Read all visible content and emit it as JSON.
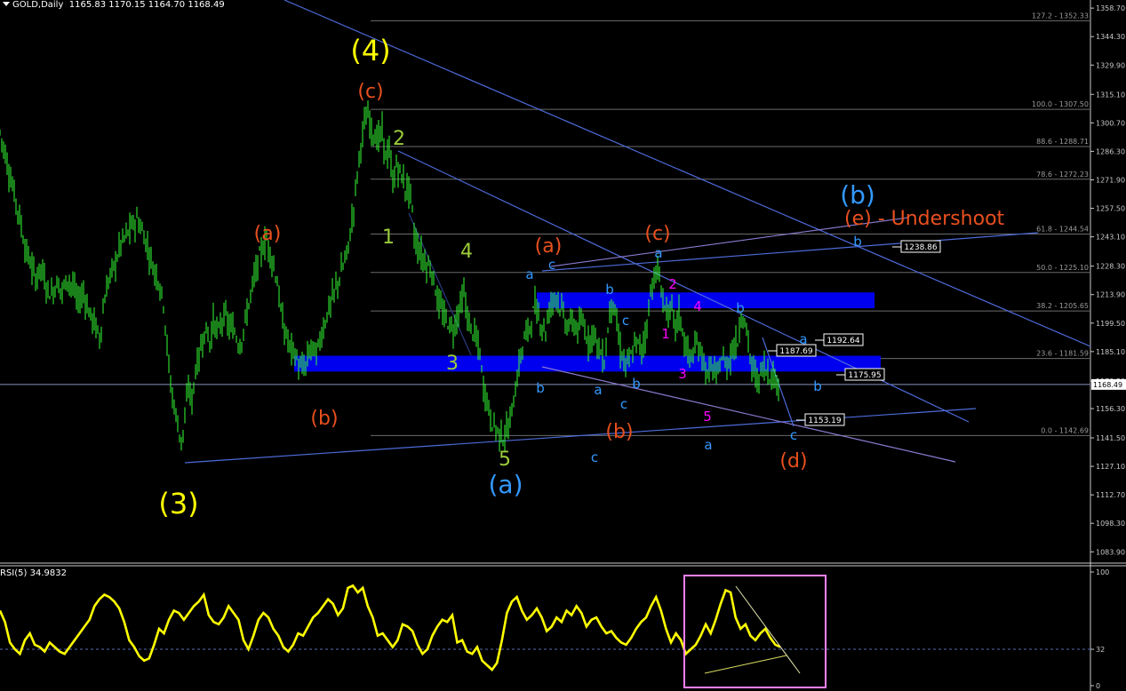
{
  "header": {
    "symbol": "GOLD,Daily",
    "ohlc": "1165.83 1170.15 1164.70 1168.49"
  },
  "rsi_header": {
    "label": "RSI(5) 34.9832"
  },
  "colors": {
    "background": "#000000",
    "candle": "#33ff33",
    "trendline": "#4d6bd9",
    "wave_count_b": "#3399ff",
    "wave_count_red": "#e8501e",
    "wave_count_yellow": "#ffff00",
    "wave_count_green": "#9ccc3a",
    "wave_count_magenta": "#ff00ff",
    "support_zone": "#0000ee",
    "rsi_line": "#ffff00",
    "rsi_box": "#ff80ff"
  },
  "chart_data": [
    {
      "type": "candlestick",
      "title": "GOLD,Daily",
      "price_axis": {
        "ticks": [
          "1358.70",
          "1344.30",
          "1329.90",
          "1315.10",
          "1300.70",
          "1286.30",
          "1271.90",
          "1257.50",
          "1243.10",
          "1228.30",
          "1213.90",
          "1199.50",
          "1185.10",
          "1170.30",
          "1156.30",
          "1141.50",
          "1127.10",
          "1112.70",
          "1098.30",
          "1083.90"
        ],
        "range": [
          1080.0,
          1361.0
        ],
        "current_price": "1168.49"
      },
      "close_path": [
        [
          0,
          1296
        ],
        [
          6,
          1285
        ],
        [
          10,
          1276
        ],
        [
          16,
          1265
        ],
        [
          22,
          1253
        ],
        [
          28,
          1238
        ],
        [
          34,
          1230
        ],
        [
          40,
          1222
        ],
        [
          46,
          1228
        ],
        [
          52,
          1218
        ],
        [
          58,
          1214
        ],
        [
          64,
          1220
        ],
        [
          70,
          1216
        ],
        [
          76,
          1222
        ],
        [
          82,
          1218
        ],
        [
          88,
          1210
        ],
        [
          94,
          1215
        ],
        [
          100,
          1205
        ],
        [
          106,
          1200
        ],
        [
          112,
          1192
        ],
        [
          118,
          1212
        ],
        [
          124,
          1224
        ],
        [
          130,
          1230
        ],
        [
          136,
          1240
        ],
        [
          142,
          1244
        ],
        [
          148,
          1248
        ],
        [
          154,
          1252
        ],
        [
          160,
          1246
        ],
        [
          166,
          1238
        ],
        [
          172,
          1228
        ],
        [
          178,
          1222
        ],
        [
          184,
          1210
        ],
        [
          188,
          1188
        ],
        [
          192,
          1168
        ],
        [
          196,
          1158
        ],
        [
          200,
          1148
        ],
        [
          204,
          1140
        ],
        [
          208,
          1150
        ],
        [
          212,
          1168
        ],
        [
          216,
          1160
        ],
        [
          220,
          1176
        ],
        [
          224,
          1182
        ],
        [
          228,
          1192
        ],
        [
          232,
          1196
        ],
        [
          236,
          1190
        ],
        [
          240,
          1200
        ],
        [
          246,
          1195
        ],
        [
          252,
          1204
        ],
        [
          258,
          1198
        ],
        [
          264,
          1195
        ],
        [
          270,
          1188
        ],
        [
          276,
          1200
        ],
        [
          282,
          1214
        ],
        [
          288,
          1226
        ],
        [
          294,
          1236
        ],
        [
          300,
          1242
        ],
        [
          306,
          1232
        ],
        [
          312,
          1220
        ],
        [
          316,
          1205
        ],
        [
          320,
          1196
        ],
        [
          326,
          1188
        ],
        [
          332,
          1184
        ],
        [
          338,
          1176
        ],
        [
          344,
          1178
        ],
        [
          350,
          1188
        ],
        [
          356,
          1184
        ],
        [
          362,
          1194
        ],
        [
          368,
          1204
        ],
        [
          374,
          1212
        ],
        [
          380,
          1220
        ],
        [
          386,
          1228
        ],
        [
          392,
          1238
        ],
        [
          398,
          1258
        ],
        [
          402,
          1275
        ],
        [
          406,
          1290
        ],
        [
          410,
          1300
        ],
        [
          414,
          1304
        ],
        [
          418,
          1298
        ],
        [
          424,
          1292
        ],
        [
          430,
          1296
        ],
        [
          434,
          1284
        ],
        [
          438,
          1286
        ],
        [
          442,
          1270
        ],
        [
          446,
          1279
        ],
        [
          450,
          1276
        ],
        [
          456,
          1268
        ],
        [
          462,
          1266
        ],
        [
          466,
          1244
        ],
        [
          470,
          1238
        ],
        [
          476,
          1232
        ],
        [
          482,
          1228
        ],
        [
          486,
          1226
        ],
        [
          492,
          1212
        ],
        [
          498,
          1204
        ],
        [
          504,
          1200
        ],
        [
          510,
          1196
        ],
        [
          516,
          1206
        ],
        [
          522,
          1214
        ],
        [
          528,
          1198
        ],
        [
          534,
          1194
        ],
        [
          540,
          1184
        ],
        [
          544,
          1166
        ],
        [
          548,
          1162
        ],
        [
          552,
          1150
        ],
        [
          556,
          1148
        ],
        [
          560,
          1145
        ],
        [
          566,
          1142
        ],
        [
          572,
          1146
        ],
        [
          578,
          1160
        ],
        [
          584,
          1178
        ],
        [
          590,
          1192
        ],
        [
          596,
          1198
        ],
        [
          602,
          1208
        ],
        [
          608,
          1200
        ],
        [
          614,
          1196
        ],
        [
          620,
          1210
        ],
        [
          626,
          1214
        ],
        [
          632,
          1206
        ],
        [
          638,
          1198
        ],
        [
          644,
          1200
        ],
        [
          650,
          1196
        ],
        [
          656,
          1200
        ],
        [
          662,
          1190
        ],
        [
          668,
          1196
        ],
        [
          674,
          1186
        ],
        [
          680,
          1180
        ],
        [
          686,
          1204
        ],
        [
          690,
          1212
        ],
        [
          694,
          1198
        ],
        [
          698,
          1186
        ],
        [
          704,
          1178
        ],
        [
          710,
          1182
        ],
        [
          716,
          1190
        ],
        [
          722,
          1186
        ],
        [
          728,
          1198
        ],
        [
          732,
          1216
        ],
        [
          736,
          1222
        ],
        [
          740,
          1226
        ],
        [
          744,
          1216
        ],
        [
          748,
          1208
        ],
        [
          752,
          1204
        ],
        [
          756,
          1206
        ],
        [
          760,
          1198
        ],
        [
          764,
          1204
        ],
        [
          768,
          1196
        ],
        [
          772,
          1186
        ],
        [
          778,
          1182
        ],
        [
          784,
          1188
        ],
        [
          790,
          1184
        ],
        [
          796,
          1172
        ],
        [
          800,
          1178
        ],
        [
          806,
          1172
        ],
        [
          812,
          1182
        ],
        [
          818,
          1178
        ],
        [
          824,
          1186
        ],
        [
          830,
          1190
        ],
        [
          834,
          1204
        ],
        [
          838,
          1200
        ],
        [
          842,
          1190
        ],
        [
          846,
          1176
        ],
        [
          850,
          1174
        ],
        [
          854,
          1170
        ],
        [
          858,
          1178
        ],
        [
          862,
          1176
        ],
        [
          866,
          1174
        ],
        [
          870,
          1172
        ],
        [
          874,
          1170
        ],
        [
          878,
          1168
        ]
      ],
      "fibonacci_levels": [
        {
          "label": "127.2 - 1352.33",
          "price": 1352.33
        },
        {
          "label": "100.0 - 1307.50",
          "price": 1307.5
        },
        {
          "label": "88.6 - 1288.71",
          "price": 1288.71
        },
        {
          "label": "78.6 - 1272.23",
          "price": 1272.23
        },
        {
          "label": "61.8 - 1244.54",
          "price": 1244.54
        },
        {
          "label": "50.0 - 1225.10",
          "price": 1225.1
        },
        {
          "label": "38.2 - 1205.65",
          "price": 1205.65
        },
        {
          "label": "23.6 - 1181.59",
          "price": 1181.59
        },
        {
          "label": "0.0 - 1142.69",
          "price": 1142.69
        }
      ],
      "price_boxes": [
        "1238.86",
        "1192.64",
        "1187.69",
        "1175.95",
        "1153.19"
      ],
      "wave_labels": {
        "yellow": [
          "(4)",
          "(3)"
        ],
        "red": [
          "(c)",
          "(a)",
          "(b)",
          "(a)",
          "(c)",
          "(b)",
          "(d)",
          "(e) - Undershoot"
        ],
        "green": [
          "2",
          "1",
          "4",
          "3",
          "5"
        ],
        "cyan_big": [
          "(a)",
          "(b)"
        ],
        "blue": [
          "a",
          "c",
          "b",
          "b",
          "a",
          "c",
          "b",
          "c",
          "a",
          "b",
          "a",
          "b",
          "c",
          "a",
          "b",
          "c"
        ],
        "magenta": [
          "2",
          "4",
          "1",
          "3",
          "5"
        ]
      }
    },
    {
      "type": "line",
      "title": "RSI(5) 34.9832",
      "y_ticks": [
        "100",
        "32",
        "0"
      ],
      "level": 32,
      "values": [
        66,
        56,
        38,
        32,
        28,
        40,
        46,
        36,
        34,
        30,
        38,
        34,
        30,
        28,
        34,
        40,
        46,
        52,
        58,
        70,
        76,
        80,
        78,
        74,
        68,
        56,
        40,
        34,
        26,
        22,
        24,
        36,
        50,
        46,
        58,
        66,
        64,
        58,
        64,
        70,
        74,
        80,
        62,
        56,
        54,
        60,
        70,
        64,
        58,
        40,
        32,
        44,
        58,
        64,
        60,
        50,
        44,
        34,
        30,
        36,
        46,
        44,
        52,
        60,
        64,
        70,
        76,
        72,
        62,
        68,
        86,
        88,
        82,
        86,
        70,
        60,
        44,
        46,
        40,
        34,
        40,
        54,
        52,
        48,
        36,
        28,
        32,
        44,
        52,
        58,
        56,
        62,
        38,
        40,
        30,
        28,
        34,
        22,
        18,
        14,
        20,
        40,
        64,
        74,
        78,
        66,
        58,
        62,
        68,
        60,
        48,
        52,
        60,
        56,
        66,
        62,
        70,
        64,
        52,
        58,
        60,
        52,
        46,
        48,
        42,
        38,
        36,
        42,
        50,
        56,
        60,
        70,
        78,
        66,
        50,
        38,
        46,
        40,
        28,
        32,
        36,
        44,
        54,
        46,
        58,
        72,
        84,
        82,
        60,
        50,
        54,
        44,
        40,
        46,
        50,
        42,
        36,
        34
      ]
    }
  ]
}
